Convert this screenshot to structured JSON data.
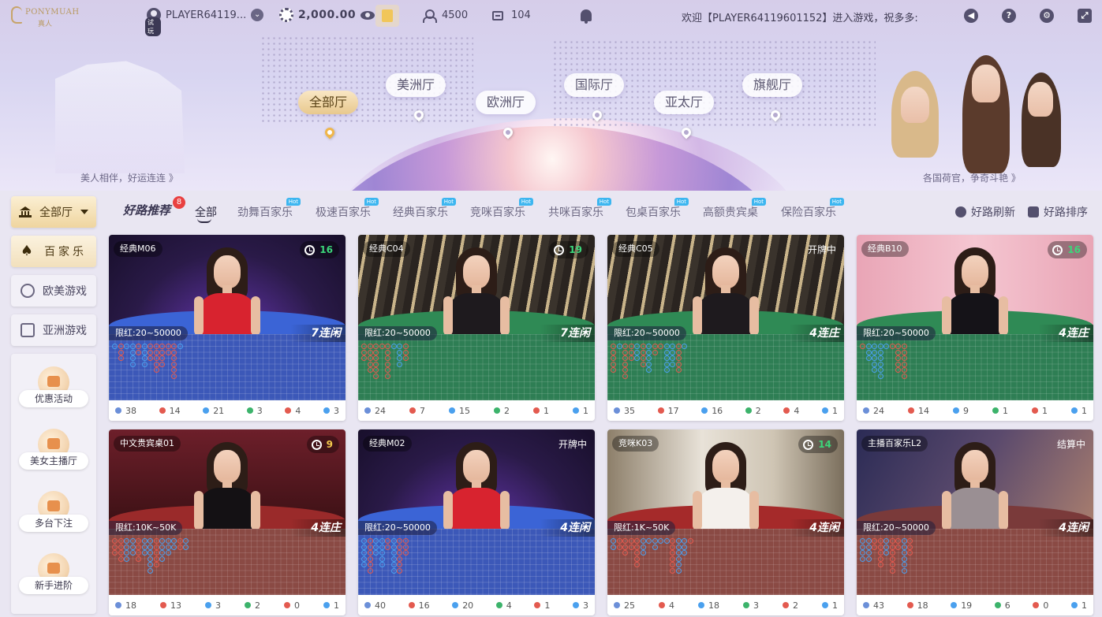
{
  "topbar": {
    "logo_text": "PONYMUAH",
    "logo_sub": "真人",
    "username": "PLAYER64119...",
    "trial_badge": "试玩",
    "balance": "2,000.00",
    "online_count": "4500",
    "table_count": "104",
    "marquee": "欢迎【PLAYER64119601152】进入游戏，祝多多:",
    "icons": [
      "volume-icon",
      "help-icon",
      "settings-icon",
      "fullscreen-icon"
    ]
  },
  "banner": {
    "regions": [
      "全部厅",
      "美洲厅",
      "欧洲厅",
      "国际厅",
      "亚太厅",
      "旗舰厅"
    ],
    "active_region": "全部厅",
    "left_tagline": "美人相伴，好运连连 》",
    "right_tagline": "各国荷官，争奇斗艳 》"
  },
  "sidebar": {
    "hall_select": "全部厅",
    "items": [
      "百家乐",
      "欧美游戏",
      "亚洲游戏"
    ],
    "promos": [
      "优惠活动",
      "美女主播厅",
      "多台下注",
      "新手进阶"
    ]
  },
  "filters": {
    "title": "好路推荐",
    "badge": "8",
    "all_tab": "全部",
    "tabs": [
      "劲舞百家乐",
      "极速百家乐",
      "经典百家乐",
      "竞咪百家乐",
      "共咪百家乐",
      "包桌百家乐",
      "高额贵宾桌",
      "保险百家乐"
    ],
    "hot_label": "Hot",
    "refresh": "好路刷新",
    "sort": "好路排序"
  },
  "cards": [
    {
      "name": "经典M06",
      "timer": "16",
      "status": "",
      "limit": "限红:20~50000",
      "streak": "7连闲",
      "board": "blue",
      "stats": [
        "38",
        "14",
        "21",
        "3",
        "4",
        "3"
      ]
    },
    {
      "name": "经典C04",
      "timer": "19",
      "status": "",
      "limit": "限红:20~50000",
      "streak": "7连闲",
      "board": "green",
      "stats": [
        "24",
        "7",
        "15",
        "2",
        "1",
        "1"
      ]
    },
    {
      "name": "经典C05",
      "timer": "",
      "status": "开牌中",
      "limit": "限红:20~50000",
      "streak": "4连庄",
      "board": "green",
      "stats": [
        "35",
        "17",
        "16",
        "2",
        "4",
        "1"
      ]
    },
    {
      "name": "经典B10",
      "timer": "16",
      "status": "",
      "limit": "限红:20~50000",
      "streak": "4连庄",
      "board": "green",
      "stats": [
        "24",
        "14",
        "9",
        "1",
        "1",
        "1"
      ]
    },
    {
      "name": "中文贵宾桌01",
      "timer": "9",
      "status": "",
      "limit": "限红:10K~50K",
      "streak": "4连庄",
      "board": "red",
      "stats": [
        "18",
        "13",
        "3",
        "2",
        "0",
        "1"
      ]
    },
    {
      "name": "经典M02",
      "timer": "",
      "status": "开牌中",
      "limit": "限红:20~50000",
      "streak": "4连闲",
      "board": "blue",
      "stats": [
        "40",
        "16",
        "20",
        "4",
        "1",
        "3"
      ]
    },
    {
      "name": "竞咪K03",
      "timer": "14",
      "status": "",
      "limit": "限红:1K~50K",
      "streak": "4连闲",
      "board": "red",
      "stats": [
        "25",
        "4",
        "18",
        "3",
        "2",
        "1"
      ]
    },
    {
      "name": "主播百家乐L2",
      "timer": "",
      "status": "结算中",
      "limit": "限红:20~50000",
      "streak": "4连闲",
      "board": "red",
      "stats": [
        "43",
        "18",
        "19",
        "6",
        "0",
        "1"
      ]
    }
  ],
  "colors": {
    "banker": "#e35a4f",
    "player": "#4aa0ee",
    "tie": "#3cb36b",
    "accent": "#e8c98e"
  }
}
